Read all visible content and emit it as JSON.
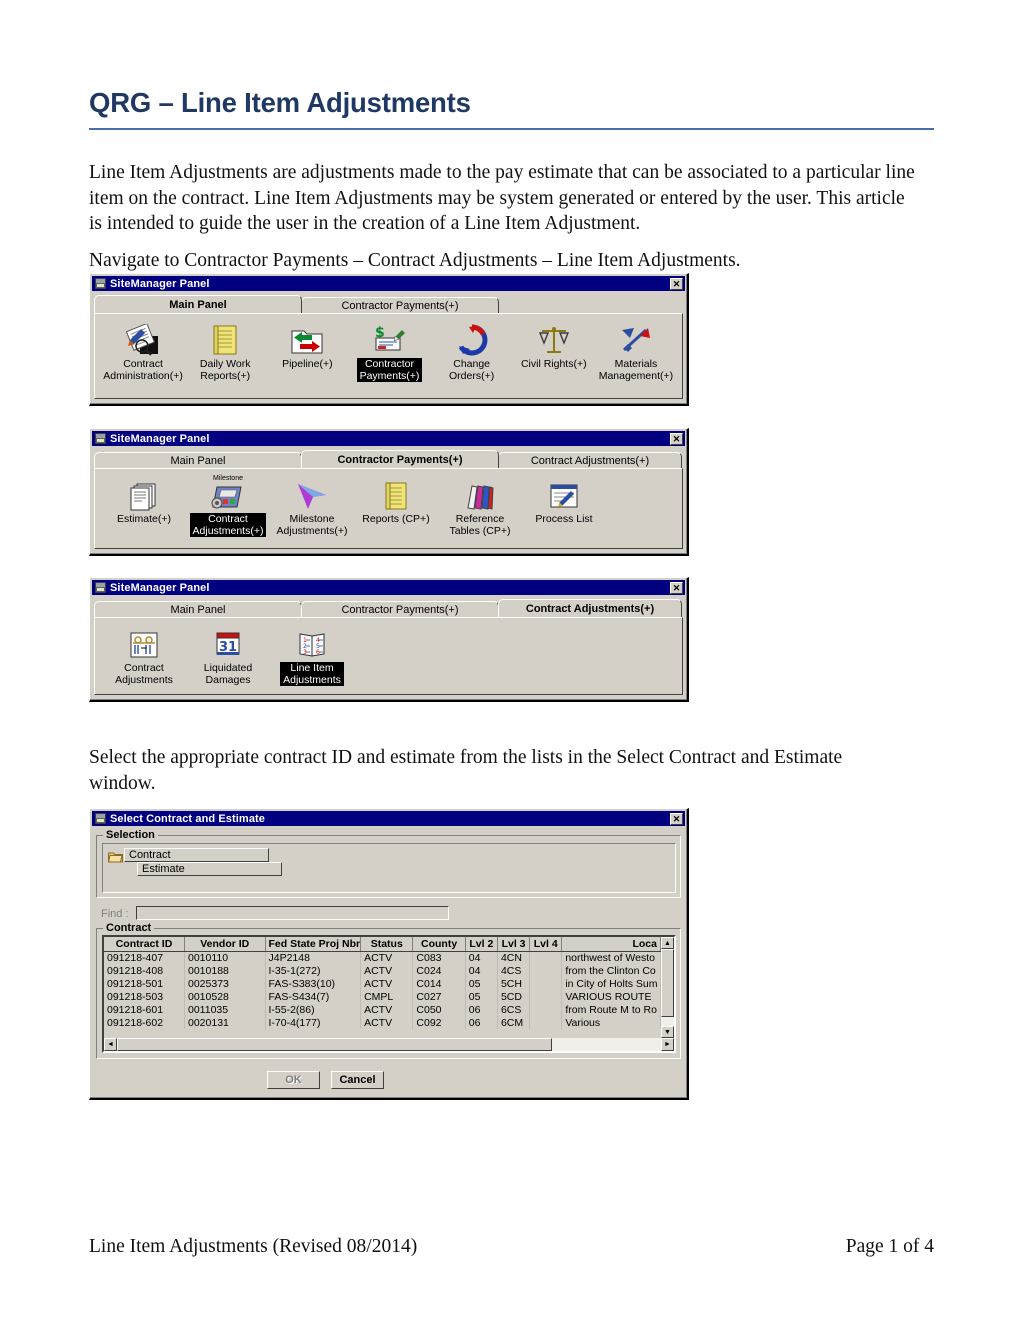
{
  "document": {
    "title": "QRG – Line Item Adjustments",
    "intro_paragraph": "Line Item Adjustments are adjustments made to the pay estimate that can be associated to a particular line item on the contract.  Line Item Adjustments may be system generated or entered by the user.  This article is intended to guide the user in the creation of a Line Item Adjustment.",
    "navigate_paragraph": "Navigate to Contractor Payments – Contract Adjustments – Line Item Adjustments.",
    "select_paragraph": "Select the appropriate contract ID and estimate from the lists in the Select Contract and Estimate window.",
    "footer_left": "Line Item Adjustments (Revised 08/2014)",
    "footer_right": "Page 1 of 4",
    "title_color": "#1F3864",
    "rule_color": "#4472A8"
  },
  "panel1": {
    "window_title": "SiteManager Panel",
    "close_label": "✕",
    "tabs": [
      {
        "label": "Main Panel",
        "active": true
      },
      {
        "label": "Contractor Payments(+)",
        "active": false
      }
    ],
    "icons": [
      {
        "caption": "Contract\nAdministration(+)",
        "selected": false,
        "icon": "contract-administration-icon"
      },
      {
        "caption": "Daily Work\nReports(+)",
        "selected": false,
        "icon": "daily-work-reports-icon"
      },
      {
        "caption": "Pipeline(+)",
        "selected": false,
        "icon": "pipeline-icon"
      },
      {
        "caption": "Contractor\nPayments(+)",
        "selected": true,
        "icon": "contractor-payments-icon"
      },
      {
        "caption": "Change\nOrders(+)",
        "selected": false,
        "icon": "change-orders-icon"
      },
      {
        "caption": "Civil Rights(+)",
        "selected": false,
        "icon": "civil-rights-icon"
      },
      {
        "caption": "Materials\nManagement(+)",
        "selected": false,
        "icon": "materials-management-icon"
      }
    ]
  },
  "panel2": {
    "window_title": "SiteManager Panel",
    "close_label": "✕",
    "tabs": [
      {
        "label": "Main Panel",
        "active": false
      },
      {
        "label": "Contractor Payments(+)",
        "active": true
      },
      {
        "label": "Contract Adjustments(+)",
        "active": false
      }
    ],
    "icons": [
      {
        "caption": "Estimate(+)",
        "selected": false,
        "icon": "estimate-icon"
      },
      {
        "caption": "Contract\nAdjustments(+)",
        "selected": true,
        "icon": "contract-adjustments-icon",
        "badge": "Milestone"
      },
      {
        "caption": "Milestone\nAdjustments(+)",
        "selected": false,
        "icon": "milestone-adjustments-icon"
      },
      {
        "caption": "Reports (CP+)",
        "selected": false,
        "icon": "reports-icon"
      },
      {
        "caption": "Reference\nTables (CP+)",
        "selected": false,
        "icon": "reference-tables-icon"
      },
      {
        "caption": "Process List",
        "selected": false,
        "icon": "process-list-icon"
      }
    ]
  },
  "panel3": {
    "window_title": "SiteManager Panel",
    "close_label": "✕",
    "tabs": [
      {
        "label": "Main Panel",
        "active": false
      },
      {
        "label": "Contractor Payments(+)",
        "active": false
      },
      {
        "label": "Contract Adjustments(+)",
        "active": true
      }
    ],
    "icons": [
      {
        "caption": "Contract\nAdjustments",
        "selected": false,
        "icon": "contract-adjustments-icon"
      },
      {
        "caption": "Liquidated\nDamages",
        "selected": false,
        "icon": "liquidated-damages-calendar-icon"
      },
      {
        "caption": "Line Item\nAdjustments",
        "selected": true,
        "icon": "line-item-adjustments-book-icon"
      }
    ]
  },
  "dialog": {
    "window_title": "Select Contract and Estimate",
    "close_label": "✕",
    "selection_group_label": "Selection",
    "tree": {
      "contract_label": "Contract",
      "estimate_label": "Estimate"
    },
    "find_label": "Find :",
    "find_value": "",
    "contract_group_label": "Contract",
    "columns": [
      "Contract ID",
      "Vendor ID",
      "Fed State Proj Nbr",
      "Status",
      "County",
      "Lvl 2",
      "Lvl 3",
      "Lvl 4",
      "Loca"
    ],
    "rows": [
      [
        "091218-407",
        "0010110",
        "J4P2148",
        "ACTV",
        "C083",
        "04",
        "4CN",
        "",
        "northwest of Westo"
      ],
      [
        "091218-408",
        "0010188",
        "I-35-1(272)",
        "ACTV",
        "C024",
        "04",
        "4CS",
        "",
        "from the Clinton Co"
      ],
      [
        "091218-501",
        "0025373",
        "FAS-S383(10)",
        "ACTV",
        "C014",
        "05",
        "5CH",
        "",
        "in City of Holts Sum"
      ],
      [
        "091218-503",
        "0010528",
        "FAS-S434(7)",
        "CMPL",
        "C027",
        "05",
        "5CD",
        "",
        "VARIOUS ROUTE"
      ],
      [
        "091218-601",
        "0011035",
        "I-55-2(86)",
        "ACTV",
        "C050",
        "06",
        "6CS",
        "",
        "from Route M to Ro"
      ],
      [
        "091218-602",
        "0020131",
        "I-70-4(177)",
        "ACTV",
        "C092",
        "06",
        "6CM",
        "",
        "Various"
      ]
    ],
    "ok_label": "OK",
    "cancel_label": "Cancel",
    "scroll_up": "▲",
    "scroll_down": "▼",
    "scroll_left": "◄",
    "scroll_right": "►"
  }
}
